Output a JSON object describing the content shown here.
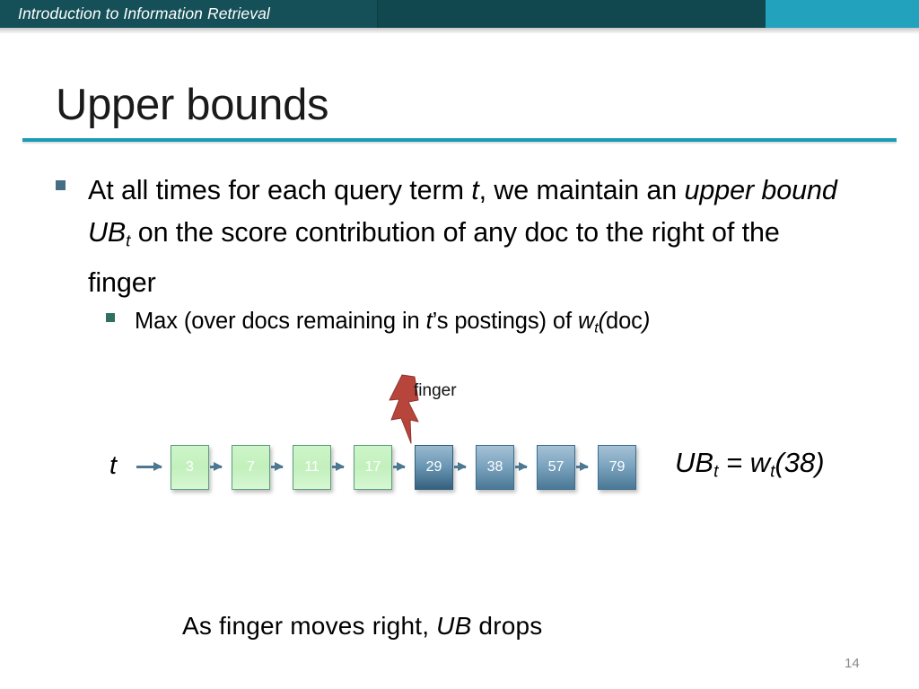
{
  "header": {
    "title": "Introduction to Information Retrieval",
    "band_color": "#155058",
    "accent_color": "#23a2bd"
  },
  "slide": {
    "title": "Upper bounds",
    "rule_color": "#1b9cb6",
    "page_number": "14"
  },
  "bullets": {
    "level1": {
      "marker_color": "#456e85",
      "html": "At all times for each query term <i>t</i>, we maintain an <i>upper bound UB<sub>t</sub></i> on the score contribution of any doc to the right of the finger",
      "plain": "At all times for each query term t, we maintain an upper bound UBt on the score contribution of any doc to the right of the finger"
    },
    "level2": {
      "marker_color": "#2f7060",
      "html": "Max (over docs remaining in <i>t</i>’s postings) of <i>w<sub>t</sub>(</i>doc<i>)</i>",
      "plain": "Max (over docs remaining in t’s postings) of wt(doc)"
    }
  },
  "diagram": {
    "term_label": "t",
    "finger_label": "finger",
    "finger_color": "#b8453c",
    "finger_at_node": "29",
    "arrow_color": "#4d7891",
    "nodes": [
      {
        "value": "3",
        "state": "passed",
        "color": "#c3f0bd"
      },
      {
        "value": "7",
        "state": "passed",
        "color": "#c3f0bd"
      },
      {
        "value": "11",
        "state": "passed",
        "color": "#c3f0bd"
      },
      {
        "value": "17",
        "state": "passed",
        "color": "#c3f0bd"
      },
      {
        "value": "29",
        "state": "current",
        "color": "#35617e"
      },
      {
        "value": "38",
        "state": "ahead",
        "color": "#4a7896"
      },
      {
        "value": "57",
        "state": "ahead",
        "color": "#4a7896"
      },
      {
        "value": "79",
        "state": "ahead",
        "color": "#4a7896"
      }
    ],
    "formula": {
      "html": "<i>UB<sub>t</sub> = w<sub>t</sub>(38)</i>",
      "plain": "UBt = wt(38)"
    }
  },
  "caption": {
    "html": "As finger moves right, <i>UB</i> drops",
    "plain": "As finger moves right, UB drops"
  }
}
